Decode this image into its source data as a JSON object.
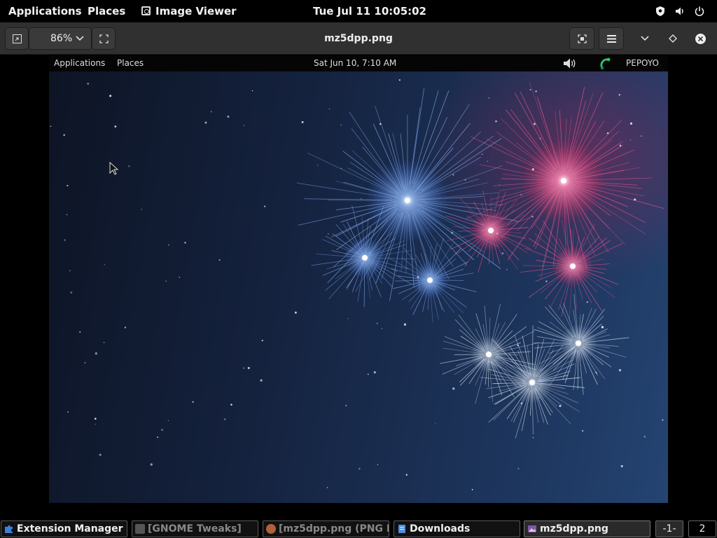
{
  "top_panel": {
    "applications": "Applications",
    "places": "Places",
    "active_app": "Image Viewer",
    "clock": "Tue Jul 11  10:05:02",
    "tray_icons": [
      "shield-icon",
      "volume-icon",
      "power-icon"
    ]
  },
  "header_bar": {
    "zoom": "86%",
    "title": "mz5dpp.png",
    "icons": [
      "fit-window-icon",
      "zoom-dropdown-icon",
      "fullscreen-icon",
      "window-size-icon",
      "menu-icon",
      "minimize-icon",
      "maximize-icon",
      "close-icon"
    ]
  },
  "inner_screenshot": {
    "applications": "Applications",
    "places": "Places",
    "clock": "Sat Jun 10,  7:10 AM",
    "user": "PEPOYO",
    "tray_icons": [
      "volume-icon",
      "network-icon"
    ]
  },
  "taskbar": {
    "tasks": [
      {
        "label": "Extension Manager",
        "icon": "puzzle-icon",
        "color": "#3d7fd9"
      },
      {
        "label": "[GNOME Tweaks]",
        "icon": "tweaks-icon",
        "color": "#6a6a6a"
      },
      {
        "label": "[mz5dpp.png (PNG I...",
        "icon": "gimp-icon",
        "color": "#b0603a"
      },
      {
        "label": "Downloads",
        "icon": "folder-icon",
        "color": "#4a8ee0"
      },
      {
        "label": "mz5dpp.png",
        "icon": "image-viewer-icon",
        "color": "#7a5aa8"
      }
    ],
    "workspaces": [
      "-1-",
      "2"
    ]
  },
  "colors": {
    "panel": "#000000",
    "headerbar": "#303030",
    "firework_blue": "#7fb0ff",
    "firework_pink": "#ff4f8f"
  }
}
